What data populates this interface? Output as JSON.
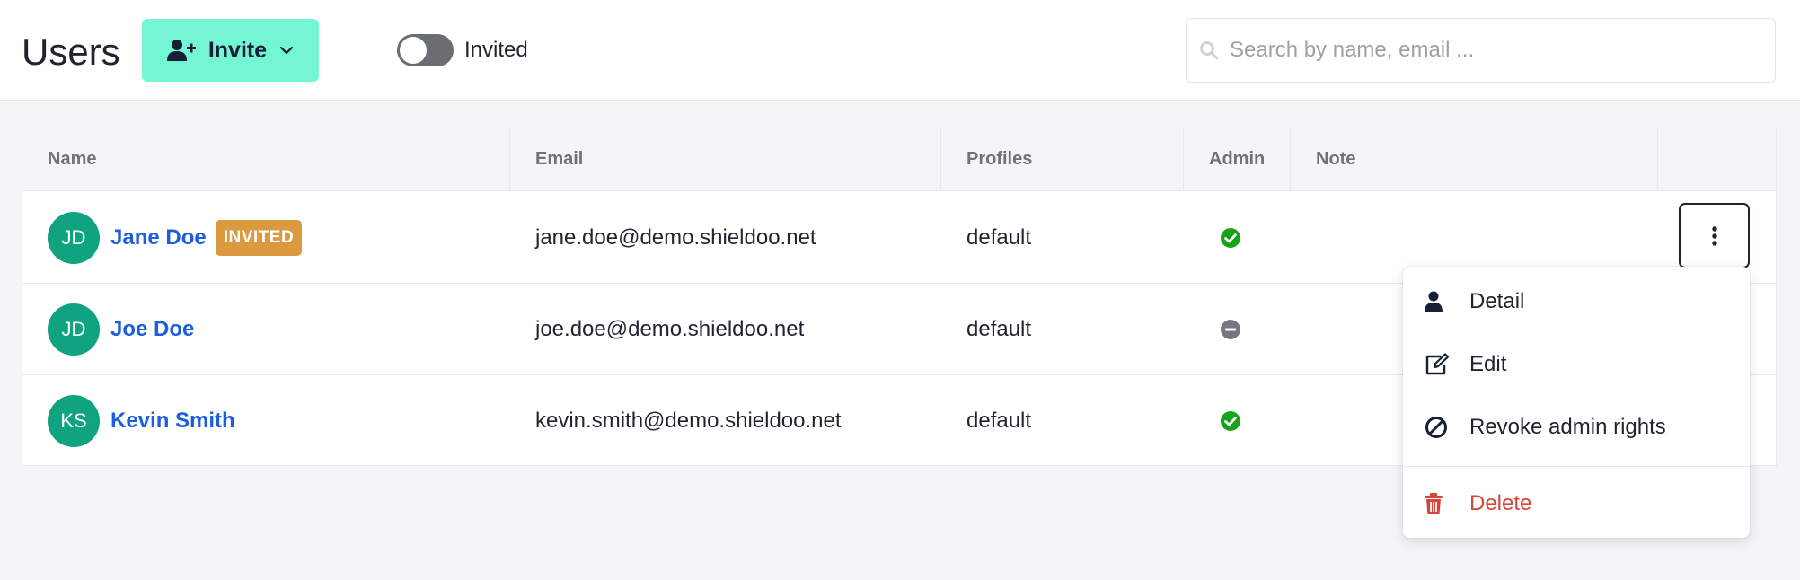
{
  "header": {
    "title": "Users",
    "invite_label": "Invite",
    "toggle_label": "Invited",
    "toggle_on": false,
    "search_placeholder": "Search by name, email ..."
  },
  "table": {
    "columns": [
      "Name",
      "Email",
      "Profiles",
      "Admin",
      "Note",
      ""
    ],
    "rows": [
      {
        "initials": "JD",
        "name": "Jane Doe",
        "badge": "INVITED",
        "email": "jane.doe@demo.shieldoo.net",
        "profiles": "default",
        "admin": true,
        "note": ""
      },
      {
        "initials": "JD",
        "name": "Joe Doe",
        "badge": "",
        "email": "joe.doe@demo.shieldoo.net",
        "profiles": "default",
        "admin": false,
        "note": ""
      },
      {
        "initials": "KS",
        "name": "Kevin Smith",
        "badge": "",
        "email": "kevin.smith@demo.shieldoo.net",
        "profiles": "default",
        "admin": true,
        "note": ""
      }
    ]
  },
  "menu": {
    "items": [
      {
        "label": "Detail",
        "icon": "user-icon"
      },
      {
        "label": "Edit",
        "icon": "edit-icon"
      },
      {
        "label": "Revoke admin rights",
        "icon": "ban-icon"
      },
      {
        "label": "Delete",
        "icon": "trash-icon"
      }
    ]
  },
  "colors": {
    "accent": "#74f5d3",
    "link": "#1d5ee0",
    "avatar": "#10a37f",
    "badge": "#dc9a40",
    "success": "#17a317",
    "danger": "#d7443a"
  }
}
